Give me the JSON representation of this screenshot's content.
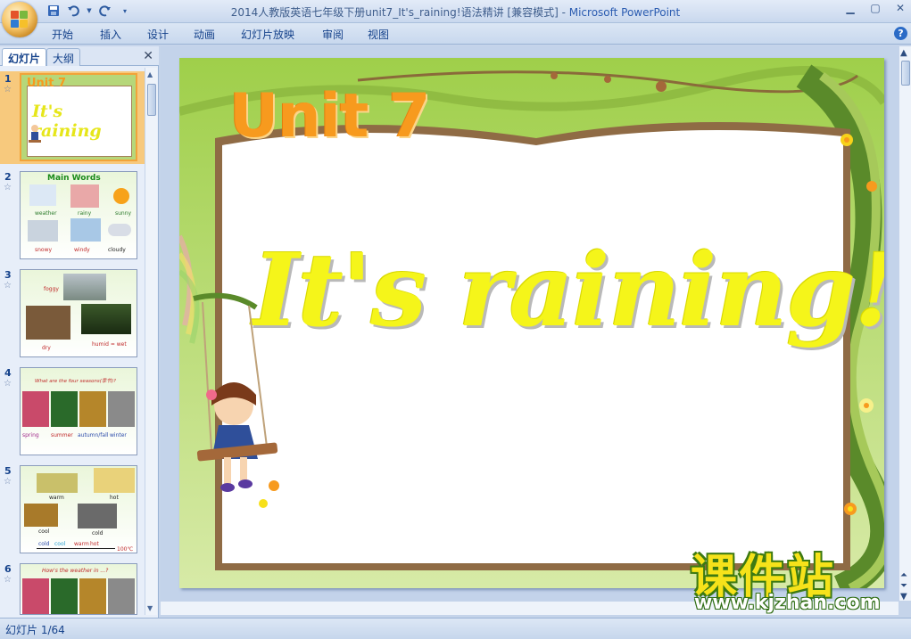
{
  "window": {
    "title": "2014人教版英语七年级下册unit7_It's_raining!语法精讲 [兼容模式]",
    "separator": " - ",
    "app": "Microsoft PowerPoint"
  },
  "qat": {
    "icons": [
      "save-icon",
      "undo-icon",
      "redo-icon",
      "customize-icon"
    ]
  },
  "ribbon": {
    "tabs": [
      "开始",
      "插入",
      "设计",
      "动画",
      "幻灯片放映",
      "审阅",
      "视图"
    ]
  },
  "left_pane": {
    "tab_slides": "幻灯片",
    "tab_outline": "大纲",
    "thumbnails": [
      {
        "num": "1",
        "title": "Unit 7",
        "subtitle": "It's raining"
      },
      {
        "num": "2",
        "title": "Main Words",
        "labels": [
          "weather",
          "rainy",
          "sunny",
          "snowy",
          "windy",
          "cloudy"
        ]
      },
      {
        "num": "3",
        "labels": [
          "foggy",
          "dry",
          "humid = wet"
        ]
      },
      {
        "num": "4",
        "title": "What are the four seasons(季节)?",
        "labels": [
          "spring",
          "summer",
          "autumn/fall",
          "winter"
        ]
      },
      {
        "num": "5",
        "labels": [
          "warm",
          "hot",
          "cool",
          "cold",
          "cold",
          "cool",
          "warm",
          "hot",
          "100℃"
        ]
      },
      {
        "num": "6",
        "title": "How's the weather in ...?",
        "labels": []
      }
    ]
  },
  "slide": {
    "unit": "Unit 7",
    "title": "It's raining!"
  },
  "watermark": {
    "cn": "课件站",
    "url": "www.kjzhan.com"
  },
  "status": {
    "slide_counter": "幻灯片 1/64"
  },
  "colors": {
    "title_yellow": "#f5f51a",
    "unit_orange": "#f79a1e",
    "selection": "#f2a33a"
  }
}
